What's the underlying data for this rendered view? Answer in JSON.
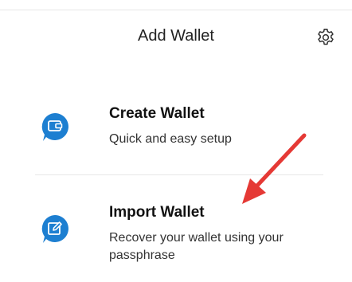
{
  "header": {
    "title": "Add Wallet",
    "settings_icon": "gear-icon"
  },
  "options": [
    {
      "title": "Create Wallet",
      "description": "Quick and easy setup",
      "icon": "wallet-icon"
    },
    {
      "title": "Import Wallet",
      "description": "Recover your wallet using your passphrase",
      "icon": "edit-icon"
    }
  ],
  "colors": {
    "accent": "#1d7fd1",
    "annotation_arrow": "#e53935"
  }
}
